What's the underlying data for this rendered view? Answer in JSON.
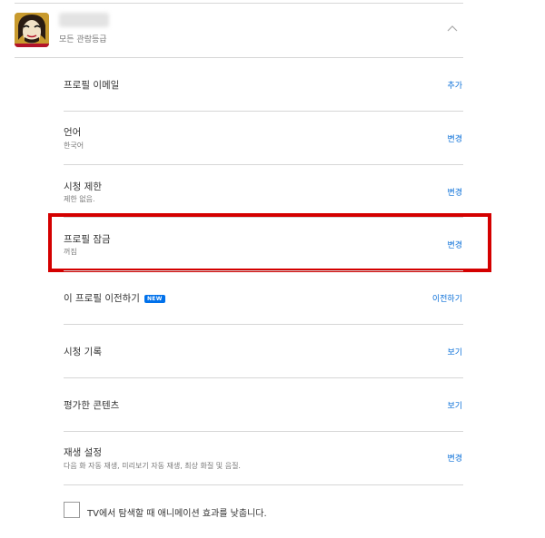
{
  "profile": {
    "maturity_label": "모든 관람등급"
  },
  "rows": [
    {
      "title": "프로필 이메일",
      "subtitle": "",
      "action": "추가"
    },
    {
      "title": "언어",
      "subtitle": "한국어",
      "action": "변경"
    },
    {
      "title": "시청 제한",
      "subtitle": "제한 없음.",
      "action": "변경"
    },
    {
      "title": "프로필 잠금",
      "subtitle": "꺼짐",
      "action": "변경"
    },
    {
      "title": "이 프로필 이전하기",
      "subtitle": "",
      "action": "이전하기",
      "badge": "NEW"
    },
    {
      "title": "시청 기록",
      "subtitle": "",
      "action": "보기"
    },
    {
      "title": "평가한 콘텐츠",
      "subtitle": "",
      "action": "보기"
    },
    {
      "title": "재생 설정",
      "subtitle": "다음 화 자동 재생, 미리보기 자동 재생, 최상 화질 및 음질.",
      "action": "변경"
    }
  ],
  "animation_option": {
    "label": "TV에서 탐색할 때 애니메이션 효과를 낮춥니다.",
    "checked": false
  },
  "colors": {
    "link": "#0a6fd8",
    "highlight": "#d40000",
    "badge": "#0071eb"
  }
}
